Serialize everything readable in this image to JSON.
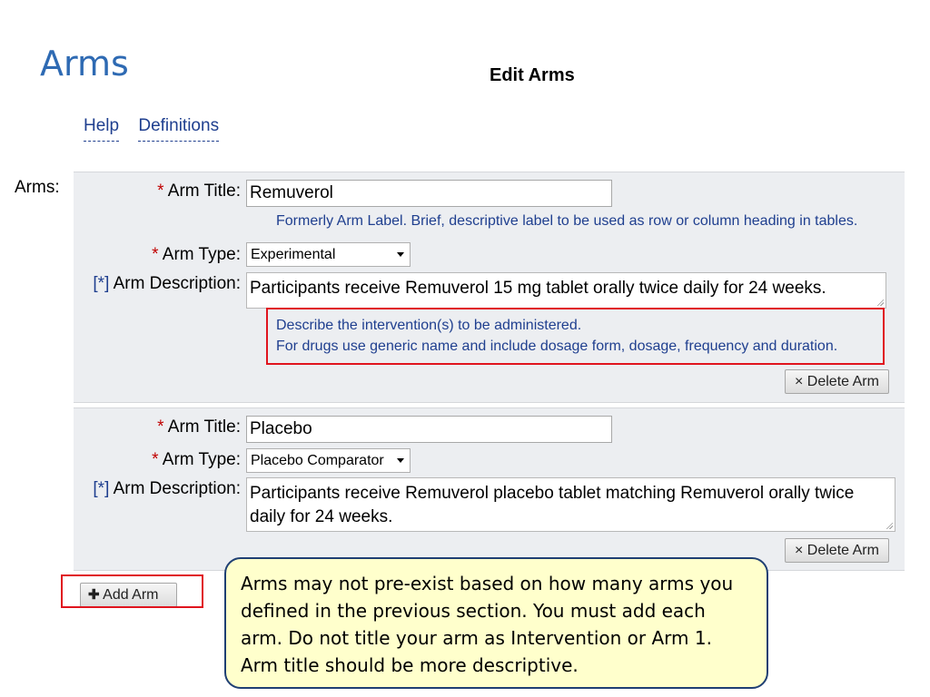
{
  "slide": {
    "title": "Arms"
  },
  "page": {
    "heading": "Edit Arms"
  },
  "links": {
    "help": "Help",
    "definitions": "Definitions"
  },
  "section_label": "Arms:",
  "labels": {
    "required_marker": "*",
    "conditional_marker": "[*]",
    "arm_title": "Arm Title:",
    "arm_type": "Arm Type:",
    "arm_description": "Arm Description:"
  },
  "arms": [
    {
      "title": "Remuverol",
      "title_hint": "Formerly Arm Label. Brief, descriptive label to be used as row or column heading in tables.",
      "type": "Experimental",
      "description": "Participants receive Remuverol 15 mg tablet orally twice daily for 24 weeks.",
      "description_hint_line1": "Describe the intervention(s) to be administered.",
      "description_hint_line2": "For drugs use generic name and include dosage form, dosage, frequency and duration.",
      "delete_label": "× Delete Arm"
    },
    {
      "title": "Placebo",
      "type": "Placebo Comparator",
      "description": "Participants receive Remuverol placebo tablet matching Remuverol orally twice daily for 24 weeks.",
      "delete_label": "× Delete Arm"
    }
  ],
  "add_arm": {
    "icon": "plus-icon",
    "icon_glyph": "✚",
    "label": "Add Arm"
  },
  "callout": {
    "text": "Arms may not pre-exist based on how many arms you defined in the previous section. You must add each arm. Do not title your arm as Intervention or Arm 1. Arm title should be more descriptive."
  },
  "colors": {
    "title_blue": "#2e6ab3",
    "highlight_red": "#e0141e",
    "callout_fill": "#ffffcc",
    "link_blue": "#1f3f8f"
  }
}
